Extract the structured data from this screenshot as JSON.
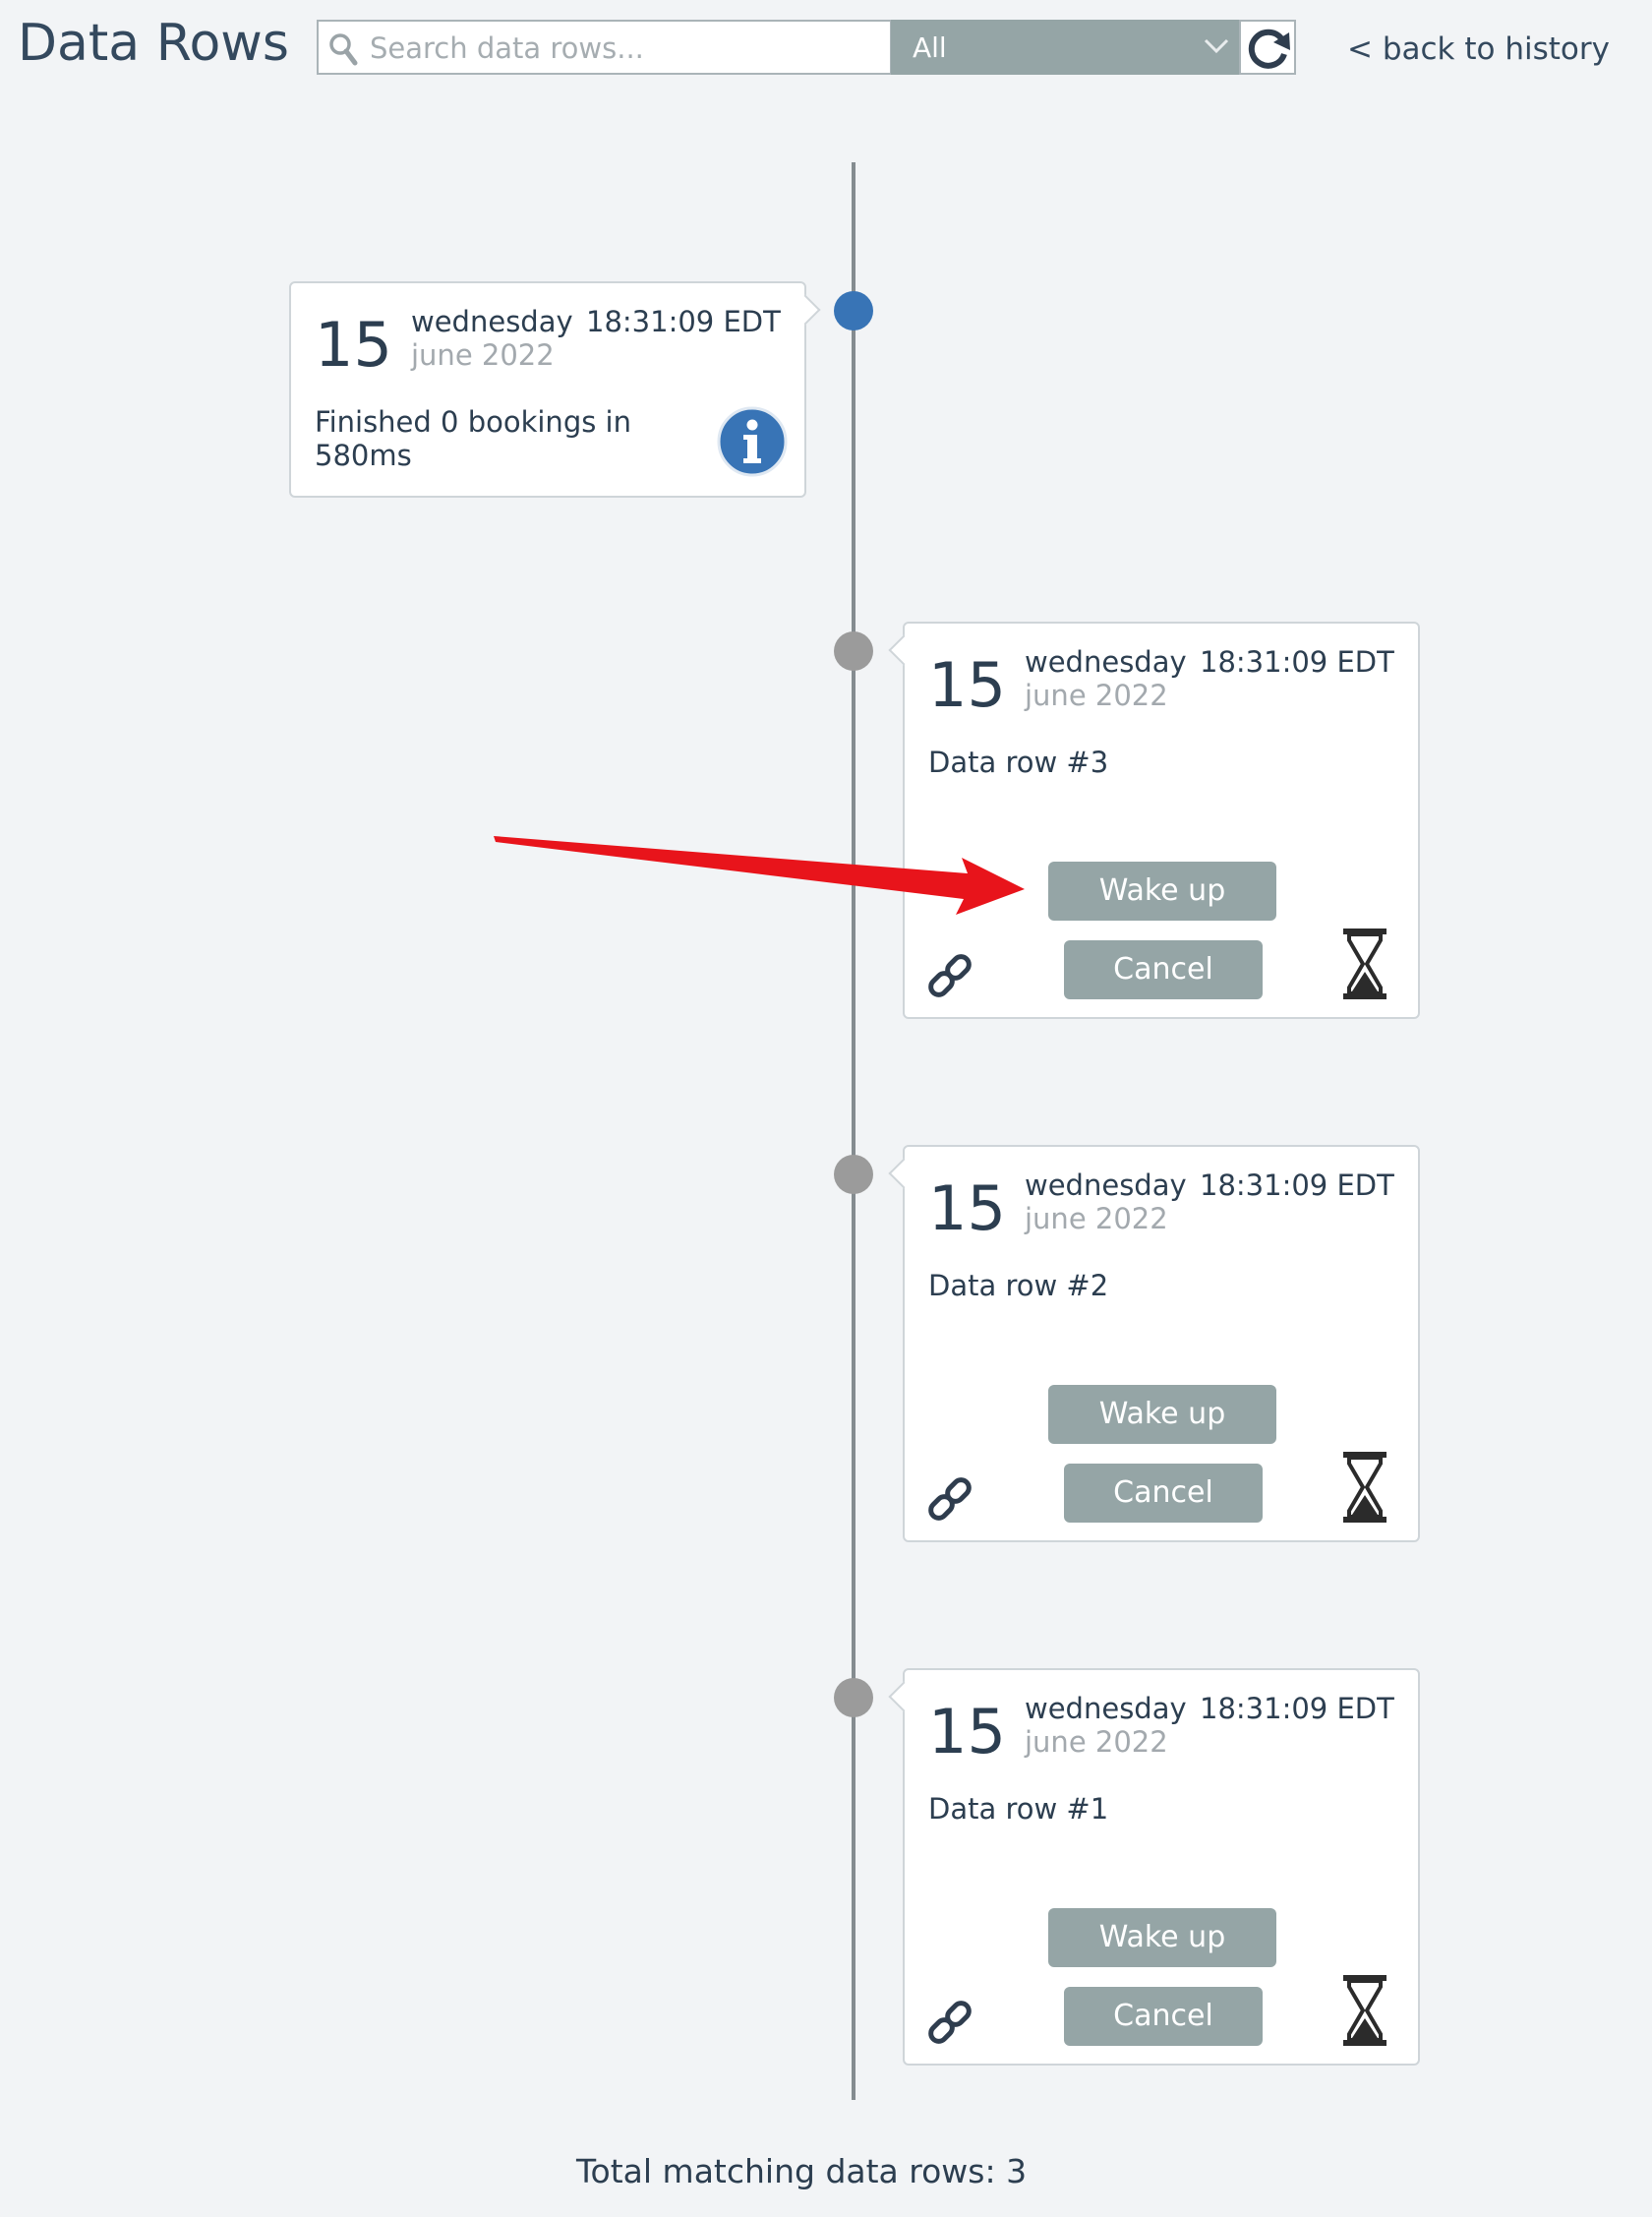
{
  "header": {
    "title": "Data Rows",
    "search_placeholder": "Search data rows...",
    "filter_value": "All",
    "back_link": "< back to history"
  },
  "summary_card": {
    "day": "15",
    "weekday": "wednesday",
    "time": "18:31:09 EDT",
    "month_year": "june 2022",
    "message": "Finished 0 bookings in 580ms"
  },
  "rows": [
    {
      "day": "15",
      "weekday": "wednesday",
      "time": "18:31:09 EDT",
      "month_year": "june 2022",
      "label": "Data row #3",
      "wake_label": "Wake up",
      "cancel_label": "Cancel"
    },
    {
      "day": "15",
      "weekday": "wednesday",
      "time": "18:31:09 EDT",
      "month_year": "june 2022",
      "label": "Data row #2",
      "wake_label": "Wake up",
      "cancel_label": "Cancel"
    },
    {
      "day": "15",
      "weekday": "wednesday",
      "time": "18:31:09 EDT",
      "month_year": "june 2022",
      "label": "Data row #1",
      "wake_label": "Wake up",
      "cancel_label": "Cancel"
    }
  ],
  "footer": {
    "total_text": "Total matching data rows: 3"
  },
  "colors": {
    "accent_blue": "#3874b6",
    "button_gray": "#95a5a6",
    "annotation_red": "#e8141b"
  }
}
